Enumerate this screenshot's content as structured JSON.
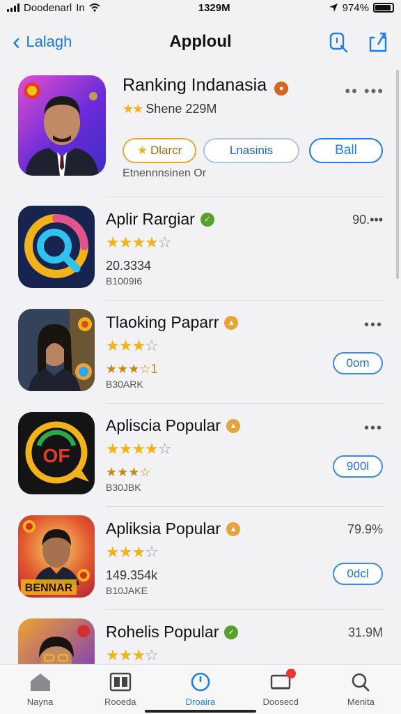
{
  "status": {
    "carrier": "Doodenarl",
    "network": "In",
    "time": "1329M",
    "battery": "974%"
  },
  "nav": {
    "back_label": "Lalagh",
    "title": "Apploul",
    "action_icons": [
      "search-icon",
      "share-icon"
    ]
  },
  "hero": {
    "title": "Ranking Indanasia",
    "rating_stars": "★★",
    "rating_text": "Shene 229M",
    "more": "•• •••",
    "buttons": [
      "Dlarcr",
      "Lnasinis",
      "Ball"
    ],
    "subtitle": "Etnennnsinen Or"
  },
  "apps": [
    {
      "name": "Aplir Rargiar",
      "stars": "★★★★",
      "stars_empty": "☆",
      "line2": "20.3334",
      "line3": "B1009I6",
      "right_text": "90.•••",
      "button": "",
      "badge_color": "#5a9e2e"
    },
    {
      "name": "Tlaoking Paparr",
      "stars": "★★★",
      "stars_empty": "☆",
      "line2": "★★★☆1",
      "line3": "B30ARK",
      "right_text": "•••",
      "button": "0om",
      "badge_color": "#e8a33a"
    },
    {
      "name": "Apliscia Popular",
      "stars": "★★★★",
      "stars_empty": "☆",
      "line2": "★★★☆",
      "line3": "B30JBK",
      "right_text": "•••",
      "button": "900l",
      "badge_color": "#e8a33a"
    },
    {
      "name": "Apliksia Popular",
      "stars": "★★★",
      "stars_empty": "☆",
      "line2": "149.354k",
      "line3": "B10JAKE",
      "right_text": "79.9%",
      "button": "0dcl",
      "badge_color": "#e8a33a"
    },
    {
      "name": "Rohelis Popular",
      "stars": "★★★",
      "stars_empty": "☆",
      "line2": "",
      "line3": "",
      "right_text": "31.9M",
      "button": "",
      "badge_color": "#5a9e2e"
    }
  ],
  "icon_text": {
    "app4_banner": "BENNAR",
    "app3_logo": "OF"
  },
  "tabs": [
    {
      "label": "Nayna",
      "icon": "home-icon",
      "active": false
    },
    {
      "label": "Rooeda",
      "icon": "book-icon",
      "active": false
    },
    {
      "label": "Droaira",
      "icon": "clock-icon",
      "active": true
    },
    {
      "label": "Doosecd",
      "icon": "inbox-icon",
      "active": false
    },
    {
      "label": "Menita",
      "icon": "search-icon",
      "active": false
    }
  ],
  "colors": {
    "accent": "#1f7de8",
    "star": "#f2b21b"
  }
}
